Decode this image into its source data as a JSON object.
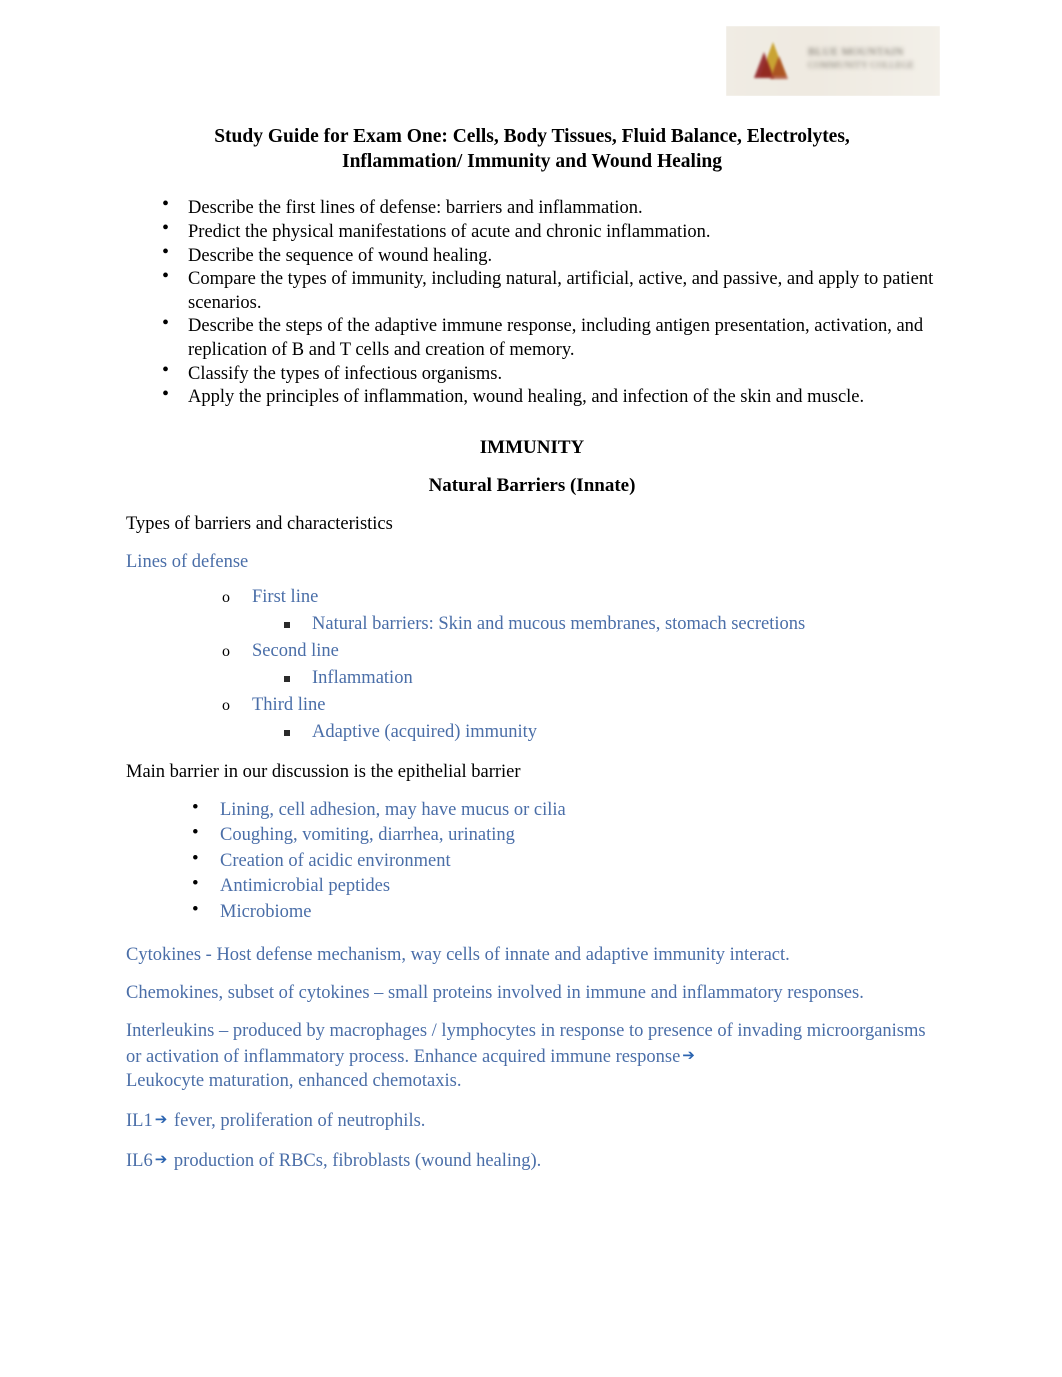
{
  "logo": {
    "line1": "BLUE MOUNTAIN",
    "line2": "COMMUNITY COLLEGE",
    "mark": "triangle-logo-icon"
  },
  "title": {
    "line1": "Study Guide for Exam One: Cells, Body Tissues, Fluid Balance, Electrolytes,",
    "line2": "Inflammation/ Immunity and Wound Healing"
  },
  "objectives": [
    "Describe the first lines of defense: barriers and inflammation.",
    "Predict the physical manifestations of acute and chronic inflammation.",
    "Describe the sequence of wound healing.",
    "Compare the types of immunity, including natural, artificial, active, and passive, and apply to patient scenarios.",
    "Describe the steps of the adaptive immune response, including antigen presentation, activation, and replication of B and T cells and creation of memory.",
    "Classify the types of infectious organisms.",
    "Apply the principles of inflammation, wound healing, and infection of the skin and muscle."
  ],
  "headings": {
    "immunity": "IMMUNITY",
    "natural_barriers": "Natural Barriers (Innate)"
  },
  "body": {
    "types_of_barriers": "Types of barriers and characteristics",
    "lines_of_defense": "Lines of defense",
    "defense_lines": [
      {
        "label": "First line",
        "detail": "Natural barriers: Skin and mucous membranes, stomach secretions"
      },
      {
        "label": "Second line",
        "detail": "Inflammation"
      },
      {
        "label": "Third line",
        "detail": "Adaptive (acquired) immunity"
      }
    ],
    "main_barrier": "Main barrier in our discussion is the epithelial barrier",
    "epithelial_points": [
      "Lining, cell adhesion, may have mucus or cilia",
      "Coughing, vomiting, diarrhea, urinating",
      "Creation of acidic environment",
      "Antimicrobial peptides",
      "Microbiome"
    ],
    "cytokines": "Cytokines - Host defense mechanism, way cells of innate and adaptive immunity interact.",
    "chemokines": "Chemokines, subset of cytokines – small proteins involved in immune and inflammatory responses.",
    "interleukins_part1": "Interleukins – produced by macrophages / lymphocytes in response to presence of invading microorganisms or activation of inflammatory process. Enhance acquired immune response",
    "interleukins_part2": "Leukocyte maturation, enhanced chemotaxis.",
    "il1_label": "IL1",
    "il1_text": "fever, proliferation of neutrophils.",
    "il6_label": "IL6",
    "il6_text": "production of RBCs, fibroblasts (wound healing).",
    "arrow_glyph": "➔"
  },
  "colors": {
    "blue_text": "#4a6ea8",
    "black_text": "#000000"
  }
}
